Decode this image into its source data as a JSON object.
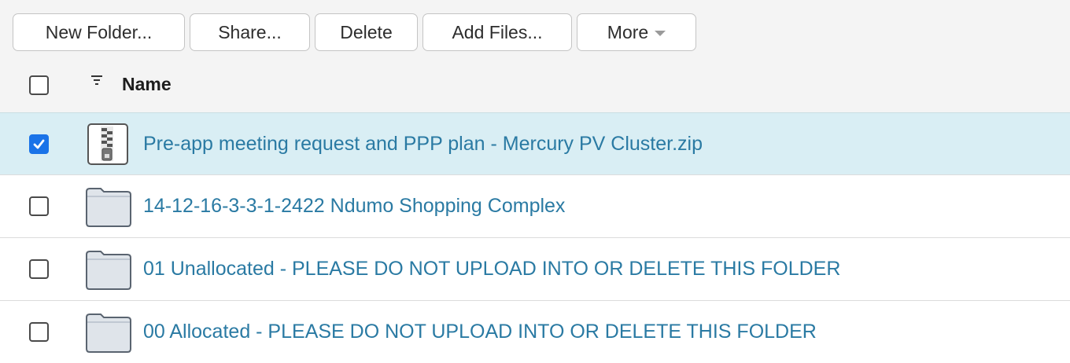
{
  "toolbar": {
    "new_folder_label": "New Folder...",
    "share_label": "Share...",
    "delete_label": "Delete",
    "add_files_label": "Add Files...",
    "more_label": "More"
  },
  "list": {
    "header": {
      "name_label": "Name"
    },
    "items": [
      {
        "name": "Pre-app meeting request and PPP plan - Mercury PV Cluster.zip",
        "type": "zip-icon",
        "selected": true
      },
      {
        "name": "14-12-16-3-3-1-2422 Ndumo Shopping Complex",
        "type": "folder-icon",
        "selected": false
      },
      {
        "name": "01 Unallocated - PLEASE DO NOT UPLOAD INTO OR DELETE THIS FOLDER",
        "type": "folder-icon",
        "selected": false
      },
      {
        "name": "00 Allocated - PLEASE DO NOT UPLOAD INTO OR DELETE THIS FOLDER",
        "type": "folder-icon",
        "selected": false
      }
    ]
  },
  "colors": {
    "link": "#2a7aa3",
    "selected_row": "#d9eef4",
    "checkbox_checked": "#1a73e8",
    "toolbar_bg": "#f4f4f4"
  }
}
